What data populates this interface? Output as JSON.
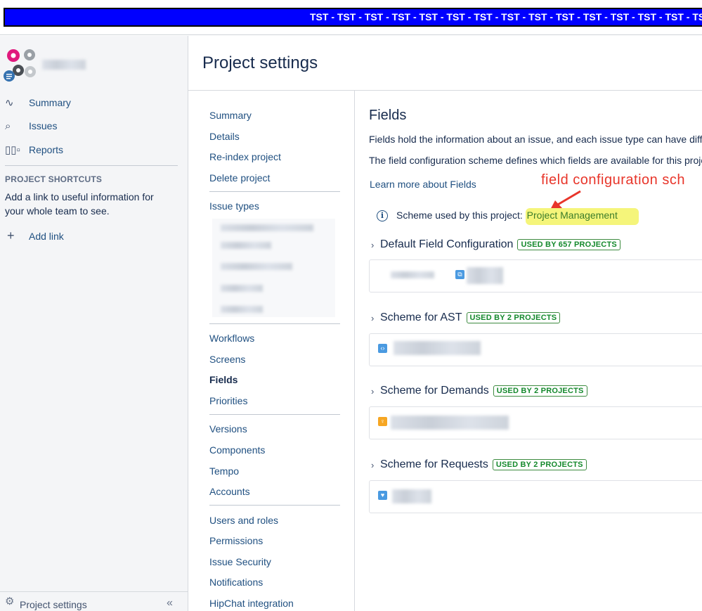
{
  "banner": {
    "text": "TST - TST - TST - TST - TST - TST - TST - TST - TST - TST - TST - TST - TST - TST - TST - TST"
  },
  "sidebar": {
    "nav": [
      {
        "label": "Summary",
        "icon": "pulse-icon"
      },
      {
        "label": "Issues",
        "icon": "search-list-icon"
      },
      {
        "label": "Reports",
        "icon": "bar-chart-icon"
      }
    ],
    "shortcuts_heading": "PROJECT SHORTCUTS",
    "shortcuts_text": "Add a link to useful information for your whole team to see.",
    "add_link": "Add link",
    "bottom_label": "Project settings",
    "collapse_glyph": "«"
  },
  "header": {
    "title": "Project settings"
  },
  "settings_nav": {
    "group1": [
      "Summary",
      "Details",
      "Re-index project",
      "Delete project"
    ],
    "issue_types": "Issue types",
    "group2": [
      "Workflows",
      "Screens",
      "Fields",
      "Priorities"
    ],
    "active": "Fields",
    "group3": [
      "Versions",
      "Components",
      "Tempo",
      "Accounts"
    ],
    "group4": [
      "Users and roles",
      "Permissions",
      "Issue Security",
      "Notifications",
      "HipChat integration"
    ]
  },
  "content": {
    "heading": "Fields",
    "desc1": "Fields hold the information about an issue, and each issue type can have diffe",
    "desc2": "The field configuration scheme defines which fields are available for this proje",
    "learn_more": "Learn more about Fields",
    "annotation": "field configuration sch",
    "scheme_used_label": "Scheme used by this project:",
    "scheme_name": "Project Management",
    "configs": [
      {
        "name": "Default Field Configuration",
        "badge": "USED BY 657 PROJECTS",
        "icon_color": "#4a9ae1"
      },
      {
        "name": "Scheme for AST",
        "badge": "USED BY 2 PROJECTS",
        "icon_color": "#4a9ae1"
      },
      {
        "name": "Scheme for Demands",
        "badge": "USED BY 2 PROJECTS",
        "icon_color": "#f6a623"
      },
      {
        "name": "Scheme for Requests",
        "badge": "USED BY 2 PROJECTS",
        "icon_color": "#4a9ae1"
      }
    ]
  },
  "colors": {
    "banner": "#0000ff",
    "link": "#205081",
    "annotation": "#e8352a",
    "highlight": "#f5f57a",
    "badge": "#14892c"
  }
}
